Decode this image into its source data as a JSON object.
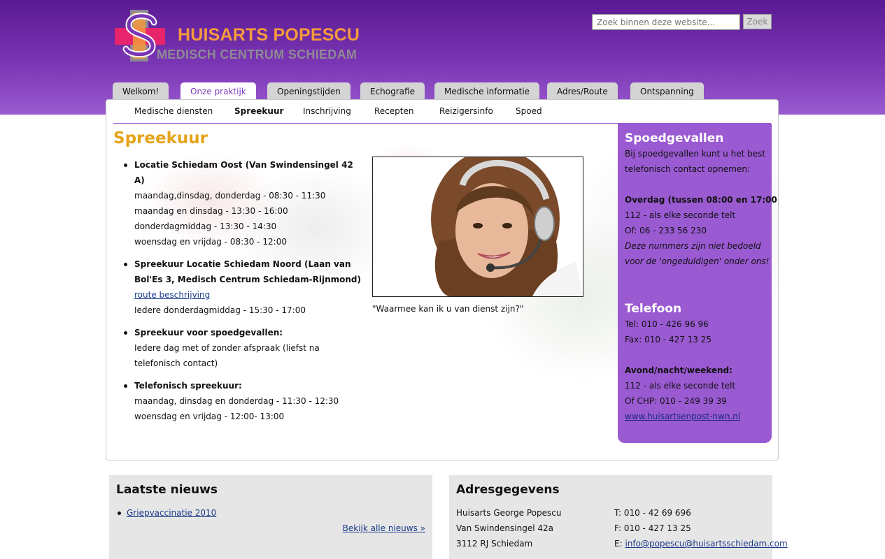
{
  "brand": {
    "title": "HUISARTS POPESCU",
    "subtitle": "MEDISCH CENTRUM SCHIEDAM",
    "colors": {
      "orange": "#f59a3d",
      "purple": "#7a35b4",
      "pink": "#e8246d",
      "gray": "#8e8a94"
    }
  },
  "search": {
    "placeholder": "Zoek binnen deze website...",
    "button_label": "Zoek"
  },
  "main_tabs": [
    {
      "label": "Welkom!",
      "active": false
    },
    {
      "label": "Onze praktijk",
      "active": true
    },
    {
      "label": "Openingstijden",
      "active": false
    },
    {
      "label": "Echografie",
      "active": false
    },
    {
      "label": "Medische informatie",
      "active": false
    },
    {
      "label": "Adres/Route",
      "active": false
    },
    {
      "label": "Ontspanning",
      "active": false
    }
  ],
  "sub_tabs": [
    {
      "label": "Medische diensten",
      "active": false
    },
    {
      "label": "Spreekuur",
      "active": true
    },
    {
      "label": "Inschrijving",
      "active": false
    },
    {
      "label": "Recepten",
      "active": false
    },
    {
      "label": "Reizigersinfo",
      "active": false
    },
    {
      "label": "Spoed",
      "active": false
    }
  ],
  "page": {
    "title": "Spreekuur",
    "schedule": [
      {
        "heading": "Locatie Schiedam Oost (Van Swindensingel 42 A)",
        "lines": [
          "maandag,dinsdag, donderdag - 08:30 - 11:30",
          "maandag en dinsdag - 13:30 - 16:00",
          "donderdagmiddag - 13:30 - 14:30",
          "woensdag en vrijdag - 08:30 - 12:00"
        ]
      },
      {
        "heading": "Spreekuur Locatie Schiedam Noord (Laan van Bol'Es 3, Medisch Centrum Schiedam-Rijnmond)",
        "link": "route beschrijving",
        "lines": [
          "Iedere donderdagmiddag - 15:30 - 17:00"
        ]
      },
      {
        "heading": "Spreekuur voor spoedgevallen:",
        "lines": [
          "Iedere dag met of zonder afspraak (liefst na telefonisch contact)"
        ]
      },
      {
        "heading": "Telefonisch spreekuur:",
        "lines": [
          "maandag, dinsdag en donderdag - 11:30 - 12:30",
          "woensdag en vrijdag - 12:00- 13:00"
        ]
      }
    ],
    "photo_caption": "\"Waarmee kan ik u van dienst zijn?\""
  },
  "sidebar": {
    "emergency_title": "Spoedgevallen",
    "emergency_intro_1": "Bij spoedgevallen kunt u het best",
    "emergency_intro_2": "telefonisch contact opnemen:",
    "day_label": "Overdag (tussen 08:00 en 17:00):",
    "day_line_1": "112 - als elke seconde telt",
    "day_line_2": "Of: 06 - 233 56 230",
    "note_1": "Deze nummers zijn niet bedoeld",
    "note_2": "voor de 'ongeduldigen' onder ons!",
    "phone_title": "Telefoon",
    "tel": "Tel: 010 - 426 96 96",
    "fax": "Fax: 010 - 427 13 25",
    "night_label": "Avond/nacht/weekend:",
    "night_line_1": "112 - als elke seconde telt",
    "night_line_2": "Of CHP: 010 - 249 39 39",
    "night_link": "www.huisartsenpost-nwn.nl"
  },
  "news": {
    "title": "Laatste nieuws",
    "items": [
      "Griepvaccinatie 2010"
    ],
    "all_link": "Bekijk alle nieuws »"
  },
  "address": {
    "title": "Adresgegevens",
    "name": "Huisarts George Popescu",
    "street": "Van Swindensingel 42a",
    "city": "3112 RJ Schiedam",
    "phone": "T: 010 - 42 69 696",
    "fax": "F: 010 - 427 13 25",
    "email_prefix": "E:",
    "email": "info@popescu@huisartsschiedam.com"
  }
}
